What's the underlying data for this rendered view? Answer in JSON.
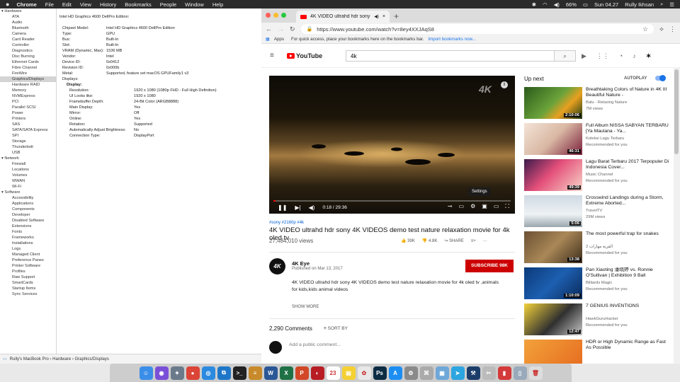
{
  "menubar": {
    "apple": "",
    "app": "Chrome",
    "items": [
      "File",
      "Edit",
      "View",
      "History",
      "Bookmarks",
      "People",
      "Window",
      "Help"
    ],
    "status": {
      "battery": "66%",
      "day_time": "Sun 04.27",
      "user": "Rully Ikhsan"
    }
  },
  "sysinfo": {
    "sidebar": [
      {
        "type": "cat",
        "label": "▾ Hardware"
      },
      {
        "label": "ATA"
      },
      {
        "label": "Audio"
      },
      {
        "label": "Bluetooth"
      },
      {
        "label": "Camera"
      },
      {
        "label": "Card Reader"
      },
      {
        "label": "Controller"
      },
      {
        "label": "Diagnostics"
      },
      {
        "label": "Disc Burning"
      },
      {
        "label": "Ethernet Cards"
      },
      {
        "label": "Fibre Channel"
      },
      {
        "label": "FireWire"
      },
      {
        "label": "Graphics/Displays",
        "selected": true
      },
      {
        "label": "Hardware RAID"
      },
      {
        "label": "Memory"
      },
      {
        "label": "NVMExpress"
      },
      {
        "label": "PCI"
      },
      {
        "label": "Parallel SCSI"
      },
      {
        "label": "Power"
      },
      {
        "label": "Printers"
      },
      {
        "label": "SAS"
      },
      {
        "label": "SATA/SATA Express"
      },
      {
        "label": "SPI"
      },
      {
        "label": "Storage"
      },
      {
        "label": "Thunderbolt"
      },
      {
        "label": "USB"
      },
      {
        "type": "cat",
        "label": "▾ Network"
      },
      {
        "label": "Firewall"
      },
      {
        "label": "Locations"
      },
      {
        "label": "Volumes"
      },
      {
        "label": "WWAN"
      },
      {
        "label": "Wi-Fi"
      },
      {
        "type": "cat",
        "label": "▾ Software"
      },
      {
        "label": "Accessibility"
      },
      {
        "label": "Applications"
      },
      {
        "label": "Components"
      },
      {
        "label": "Developer"
      },
      {
        "label": "Disabled Software"
      },
      {
        "label": "Extensions"
      },
      {
        "label": "Fonts"
      },
      {
        "label": "Frameworks"
      },
      {
        "label": "Installations"
      },
      {
        "label": "Logs"
      },
      {
        "label": "Managed Client"
      },
      {
        "label": "Preference Panes"
      },
      {
        "label": "Printer Software"
      },
      {
        "label": "Profiles"
      },
      {
        "label": "Raw Support"
      },
      {
        "label": "SmartCards"
      },
      {
        "label": "Startup Items"
      },
      {
        "label": "Sync Services"
      }
    ],
    "heading": "Intel HD Graphics 4600 DellPro Edition:",
    "specs": [
      {
        "k": "Chipset Model:",
        "v": "Intel HD Graphics 4600 DellPro Edition"
      },
      {
        "k": "Type:",
        "v": "GPU"
      },
      {
        "k": "Bus:",
        "v": "Built-In"
      },
      {
        "k": "Slot:",
        "v": "Built-In"
      },
      {
        "k": "VRAM (Dynamic, Max):",
        "v": "1536 MB"
      },
      {
        "k": "Vendor:",
        "v": "Intel"
      },
      {
        "k": "Device ID:",
        "v": "0x0412"
      },
      {
        "k": "Revision ID:",
        "v": "0x000b"
      },
      {
        "k": "Metal:",
        "v": "Supported, feature set macOS GPUFamily1 v3"
      }
    ],
    "displays_label": "Displays:",
    "display_label": "Display:",
    "display_specs": [
      {
        "k": "Resolution:",
        "v": "1920 x 1080 (1080p FHD - Full High Definition)"
      },
      {
        "k": "UI Looks like:",
        "v": "1920 x 1080"
      },
      {
        "k": "Framebuffer Depth:",
        "v": "24-Bit Color (ARGB8888)"
      },
      {
        "k": "Main Display:",
        "v": "Yes"
      },
      {
        "k": "Mirror:",
        "v": "Off"
      },
      {
        "k": "Online:",
        "v": "Yes"
      },
      {
        "k": "Rotation:",
        "v": "Supported"
      },
      {
        "k": "Automatically Adjust Brightness:",
        "v": "No"
      },
      {
        "k": "Connection Type:",
        "v": "DisplayPort"
      }
    ],
    "footer": "Rully's MacBook Pro  ›  Hardware  ›  Graphics/Displays"
  },
  "chrome": {
    "tab_title": "4K VIDEO ultrahd hdr sony",
    "url": "https://www.youtube.com/watch?v=8ey4XXJAqS8",
    "bookmarks": {
      "apps": "Apps",
      "hint": "For quick access, place your bookmarks here on the bookmarks bar.",
      "import": "Import bookmarks now..."
    }
  },
  "youtube": {
    "logo": "YouTube",
    "search_value": "4k",
    "player": {
      "watermark": "4K",
      "tooltip": "Settings",
      "time": "0:18 / 29:36",
      "progress": 0.01
    },
    "tags": "#sony #2160p #4k",
    "title": "4K VIDEO ultrahd hdr sony 4K VIDEOS demo test nature relaxation movie for 4k oled tv",
    "views": "27,484,010 views",
    "likes": "39K",
    "dislikes": "4.8K",
    "share": "SHARE",
    "channel": "4K Eye",
    "avatar_text": "4K",
    "published": "Published on Mar 13, 2017",
    "subscribe": "SUBSCRIBE  98K",
    "description": "4K VIDEO ultrahd hdr sony 4K VIDEOS demo test nature relaxation movie for 4k oled tv ,animals for kids,kids animal videos",
    "show_more": "SHOW MORE",
    "comments_count": "2,290 Comments",
    "sort_by": "SORT BY",
    "add_comment": "Add a public comment..."
  },
  "upnext": {
    "label": "Up next",
    "autoplay": "AUTOPLAY",
    "items": [
      {
        "title": "Breathtaking Colors of Nature in 4K III  Beautiful Nature -",
        "channel": "Balu - Relaxing Nature",
        "meta": "7M views",
        "duration": "2:10:06",
        "bg": "linear-gradient(135deg,#2b5a1a,#6aa33a 50%,#e8a020 70%,#1d3a10)"
      },
      {
        "title": "Full Album NISSA SABYAN TERBARU [Ya Maulana - Ya...",
        "channel": "Koleksi Lagu Terbaru",
        "meta": "Recommended for you",
        "duration": "46:31",
        "bg": "linear-gradient(135deg,#f3e3d6,#d9b8a4 50%,#7a1e3a)"
      },
      {
        "title": "Lagu Barat Terbaru 2017 Terpopuler Di Indonesia Cover...",
        "channel": "Music Channel",
        "meta": "Recommended for you",
        "duration": "49:39",
        "bg": "linear-gradient(135deg,#3a1a4a,#e44f7a 45%,#f7d5c8)"
      },
      {
        "title": "Crosswind Landings during a Storm, Extreme Aborted...",
        "channel": "TravelTV",
        "meta": "29M views",
        "duration": "5:06",
        "bg": "linear-gradient(180deg,#cfd9e3,#eef2f5 60%,#9aa6ad)"
      },
      {
        "title": "The most powerful trap for snakes",
        "channel": "القرية مهارات 2",
        "meta": "Recommended for you",
        "duration": "13:38",
        "bg": "linear-gradient(135deg,#6b5133,#a98757 50%,#3e2e1c)"
      },
      {
        "title": "Pan Xiaoting 潘晓婷 vs. Ronnie O'Sullivan | Exhibition 9 Ball",
        "channel": "Billiards Magic",
        "meta": "Recommended for you",
        "duration": "1:10:09",
        "bg": "linear-gradient(135deg,#0b3a7a,#1d5fb0 50%,#0a2a5a)"
      },
      {
        "title": "7 GENIUS INVENTIONS",
        "channel": "HawkGuruHacker",
        "meta": "Recommended for you",
        "duration": "12:47",
        "bg": "linear-gradient(135deg,#f2d23a,#303030 55%,#c8c8c8)"
      },
      {
        "title": "HDR or High Dynamic Range as Fast As Possible",
        "channel": "",
        "meta": "",
        "duration": "",
        "bg": "linear-gradient(135deg,#f2a23a,#e66a20)"
      }
    ]
  },
  "dock": [
    {
      "name": "finder",
      "bg": "#3b8ee8",
      "g": "☺"
    },
    {
      "name": "siri",
      "bg": "#7a4fd8",
      "g": "◉"
    },
    {
      "name": "launchpad",
      "bg": "#6a7a8a",
      "g": "✦"
    },
    {
      "name": "chrome",
      "bg": "#db4437",
      "g": "●"
    },
    {
      "name": "safari",
      "bg": "#2b8ae0",
      "g": "◎"
    },
    {
      "name": "vscode",
      "bg": "#1e76c8",
      "g": "⧉"
    },
    {
      "name": "terminal",
      "bg": "#222",
      "g": ">_"
    },
    {
      "name": "sequel",
      "bg": "#c88a2a",
      "g": "≡"
    },
    {
      "name": "word",
      "bg": "#2b5797",
      "g": "W"
    },
    {
      "name": "excel",
      "bg": "#1e7145",
      "g": "X"
    },
    {
      "name": "powerpoint",
      "bg": "#d24726",
      "g": "P"
    },
    {
      "name": "photo-booth",
      "bg": "#b81d24",
      "g": "◐"
    },
    {
      "name": "calendar",
      "bg": "#fff",
      "g": "23"
    },
    {
      "name": "notes",
      "bg": "#f5d033",
      "g": "▤"
    },
    {
      "name": "photos",
      "bg": "#e8e8e8",
      "g": "✿"
    },
    {
      "name": "photoshop",
      "bg": "#0d2c44",
      "g": "Ps"
    },
    {
      "name": "app-store",
      "bg": "#1c8ef2",
      "g": "A"
    },
    {
      "name": "system-prefs",
      "bg": "#8a8a8a",
      "g": "⚙"
    },
    {
      "name": "system-info",
      "bg": "#aaa",
      "g": "⌘"
    },
    {
      "name": "preview",
      "bg": "#6fa7d8",
      "g": "▦"
    },
    {
      "name": "telegram",
      "bg": "#2ca5e0",
      "g": "➤"
    },
    {
      "name": "xcode",
      "bg": "#1c3d6a",
      "g": "⚒"
    },
    {
      "name": "utilities",
      "bg": "#bbb",
      "g": "✂"
    },
    {
      "name": "documents",
      "bg": "#d43a3a",
      "g": "▮"
    },
    {
      "name": "downloads",
      "bg": "#9ab",
      "g": "▯"
    },
    {
      "name": "trash",
      "bg": "#ddd",
      "g": "🗑"
    }
  ]
}
